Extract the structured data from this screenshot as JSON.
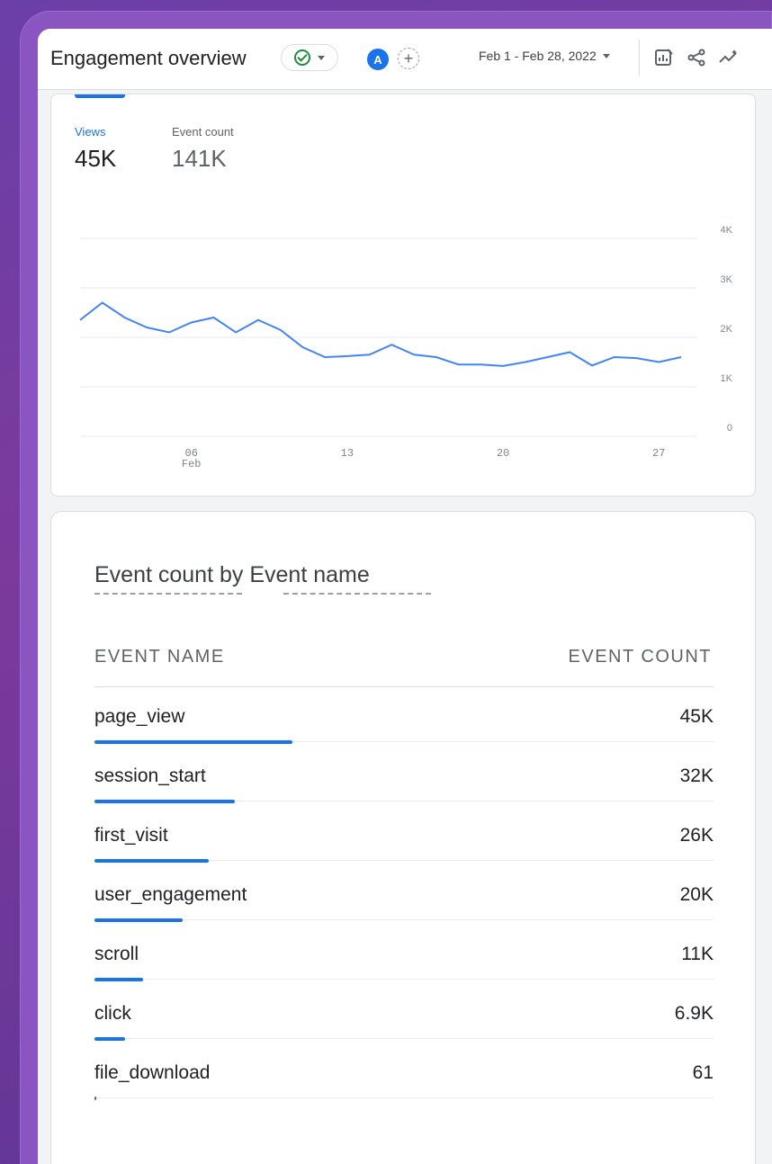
{
  "header": {
    "title": "Engagement overview",
    "avatar_letter": "A",
    "add_comparison": "+",
    "date_range": "Feb 1 - Feb 28, 2022"
  },
  "metrics": [
    {
      "label": "Views",
      "value": "45K",
      "active": true
    },
    {
      "label": "Event count",
      "value": "141K",
      "active": false
    }
  ],
  "chart_data": {
    "type": "line",
    "series": [
      {
        "name": "Views",
        "values": [
          2350,
          2700,
          2400,
          2200,
          2100,
          2300,
          2400,
          2100,
          2350,
          2150,
          1800,
          1600,
          1620,
          1650,
          1850,
          1650,
          1600,
          1450,
          1450,
          1420,
          1500,
          1600,
          1700,
          1430,
          1600,
          1580,
          1500,
          1600
        ]
      }
    ],
    "x": [
      "Feb 1",
      "Feb 2",
      "Feb 3",
      "Feb 4",
      "Feb 5",
      "Feb 6",
      "Feb 7",
      "Feb 8",
      "Feb 9",
      "Feb 10",
      "Feb 11",
      "Feb 12",
      "Feb 13",
      "Feb 14",
      "Feb 15",
      "Feb 16",
      "Feb 17",
      "Feb 18",
      "Feb 19",
      "Feb 20",
      "Feb 21",
      "Feb 22",
      "Feb 23",
      "Feb 24",
      "Feb 25",
      "Feb 26",
      "Feb 27",
      "Feb 28"
    ],
    "x_ticks": [
      {
        "day": 6,
        "label": "06",
        "sub": "Feb"
      },
      {
        "day": 13,
        "label": "13",
        "sub": ""
      },
      {
        "day": 20,
        "label": "20",
        "sub": ""
      },
      {
        "day": 27,
        "label": "27",
        "sub": ""
      }
    ],
    "y_ticks": [
      "0",
      "1K",
      "2K",
      "3K",
      "4K"
    ],
    "ylim": [
      0,
      4000
    ],
    "color": "#4285f4",
    "grid": true
  },
  "table": {
    "title_part1": "Event count by",
    "title_part2": "Event name",
    "col_name": "EVENT NAME",
    "col_count": "EVENT COUNT",
    "rows": [
      {
        "name": "page_view",
        "count": "45K",
        "value": 45000
      },
      {
        "name": "session_start",
        "count": "32K",
        "value": 32000
      },
      {
        "name": "first_visit",
        "count": "26K",
        "value": 26000
      },
      {
        "name": "user_engagement",
        "count": "20K",
        "value": 20000
      },
      {
        "name": "scroll",
        "count": "11K",
        "value": 11000
      },
      {
        "name": "click",
        "count": "6.9K",
        "value": 6900
      },
      {
        "name": "file_download",
        "count": "61",
        "value": 61
      }
    ]
  },
  "colors": {
    "accent": "#1a73e8",
    "success": "#1e8e3e"
  }
}
